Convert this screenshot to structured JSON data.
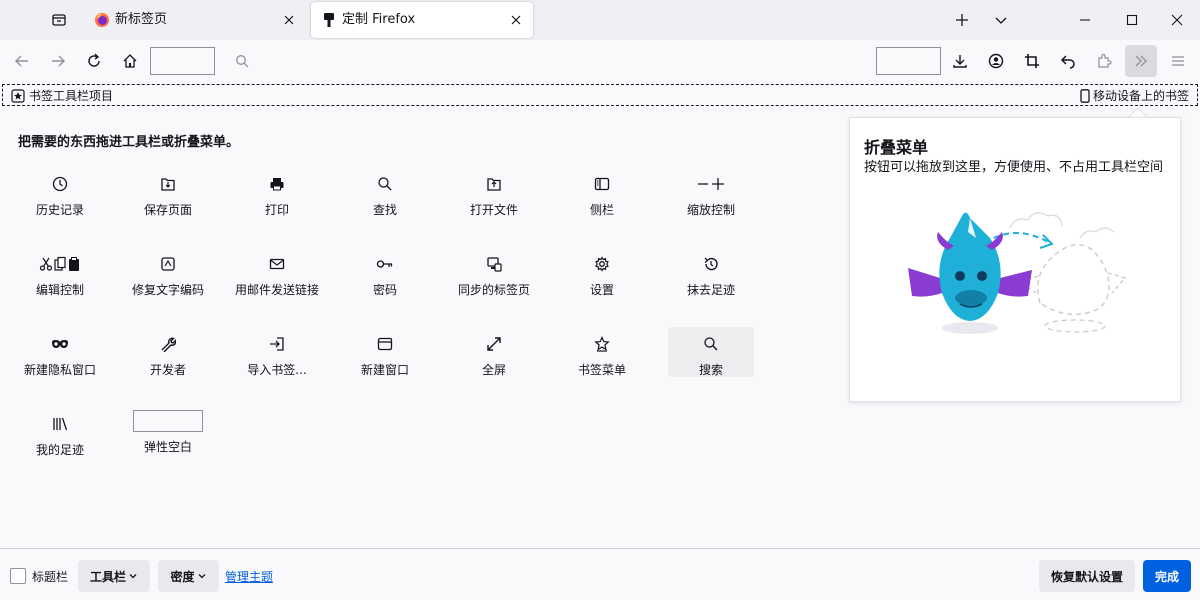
{
  "tabs": [
    {
      "label": "新标签页",
      "icon": "firefox-icon"
    },
    {
      "label": "定制 Firefox",
      "icon": "pin-icon"
    }
  ],
  "bookmarks": {
    "left_label": "书签工具栏项目",
    "right_label": "移动设备上的书签"
  },
  "palette": {
    "instructions": "把需要的东西拖进工具栏或折叠菜单。",
    "items": [
      {
        "label": "历史记录",
        "icon": "history-icon"
      },
      {
        "label": "保存页面",
        "icon": "save-page-icon"
      },
      {
        "label": "打印",
        "icon": "print-icon"
      },
      {
        "label": "查找",
        "icon": "find-icon"
      },
      {
        "label": "打开文件",
        "icon": "open-file-icon"
      },
      {
        "label": "侧栏",
        "icon": "sidebar-icon"
      },
      {
        "label": "缩放控制",
        "icon": "zoom-icon"
      },
      {
        "label": "编辑控制",
        "icon": "edit-icon"
      },
      {
        "label": "修复文字编码",
        "icon": "encoding-icon"
      },
      {
        "label": "用邮件发送链接",
        "icon": "email-icon"
      },
      {
        "label": "密码",
        "icon": "key-icon"
      },
      {
        "label": "同步的标签页",
        "icon": "synced-tabs-icon"
      },
      {
        "label": "设置",
        "icon": "gear-icon"
      },
      {
        "label": "抹去足迹",
        "icon": "forget-icon"
      },
      {
        "label": "新建隐私窗口",
        "icon": "private-window-icon"
      },
      {
        "label": "开发者",
        "icon": "wrench-icon"
      },
      {
        "label": "导入书签...",
        "icon": "import-icon"
      },
      {
        "label": "新建窗口",
        "icon": "new-window-icon"
      },
      {
        "label": "全屏",
        "icon": "fullscreen-icon"
      },
      {
        "label": "书签菜单",
        "icon": "bookmark-star-icon"
      },
      {
        "label": "搜索",
        "icon": "search-icon"
      },
      {
        "label": "我的足迹",
        "icon": "library-icon"
      },
      {
        "label": "弹性空白",
        "icon": "flexible-space"
      }
    ]
  },
  "overflow": {
    "title": "折叠菜单",
    "description": "按钮可以拖放到这里，方便使用、不占用工具栏空间"
  },
  "footer": {
    "titlebar_label": "标题栏",
    "toolbars_label": "工具栏",
    "density_label": "密度",
    "themes_link": "管理主题",
    "restore_label": "恢复默认设置",
    "done_label": "完成"
  },
  "colors": {
    "accent": "#0061e0",
    "tabstrip_bg": "#f0f0f4",
    "page_bg": "#f9f9fb",
    "dragon_blue": "#1fb0d8",
    "dragon_purple": "#8a3bd1"
  }
}
